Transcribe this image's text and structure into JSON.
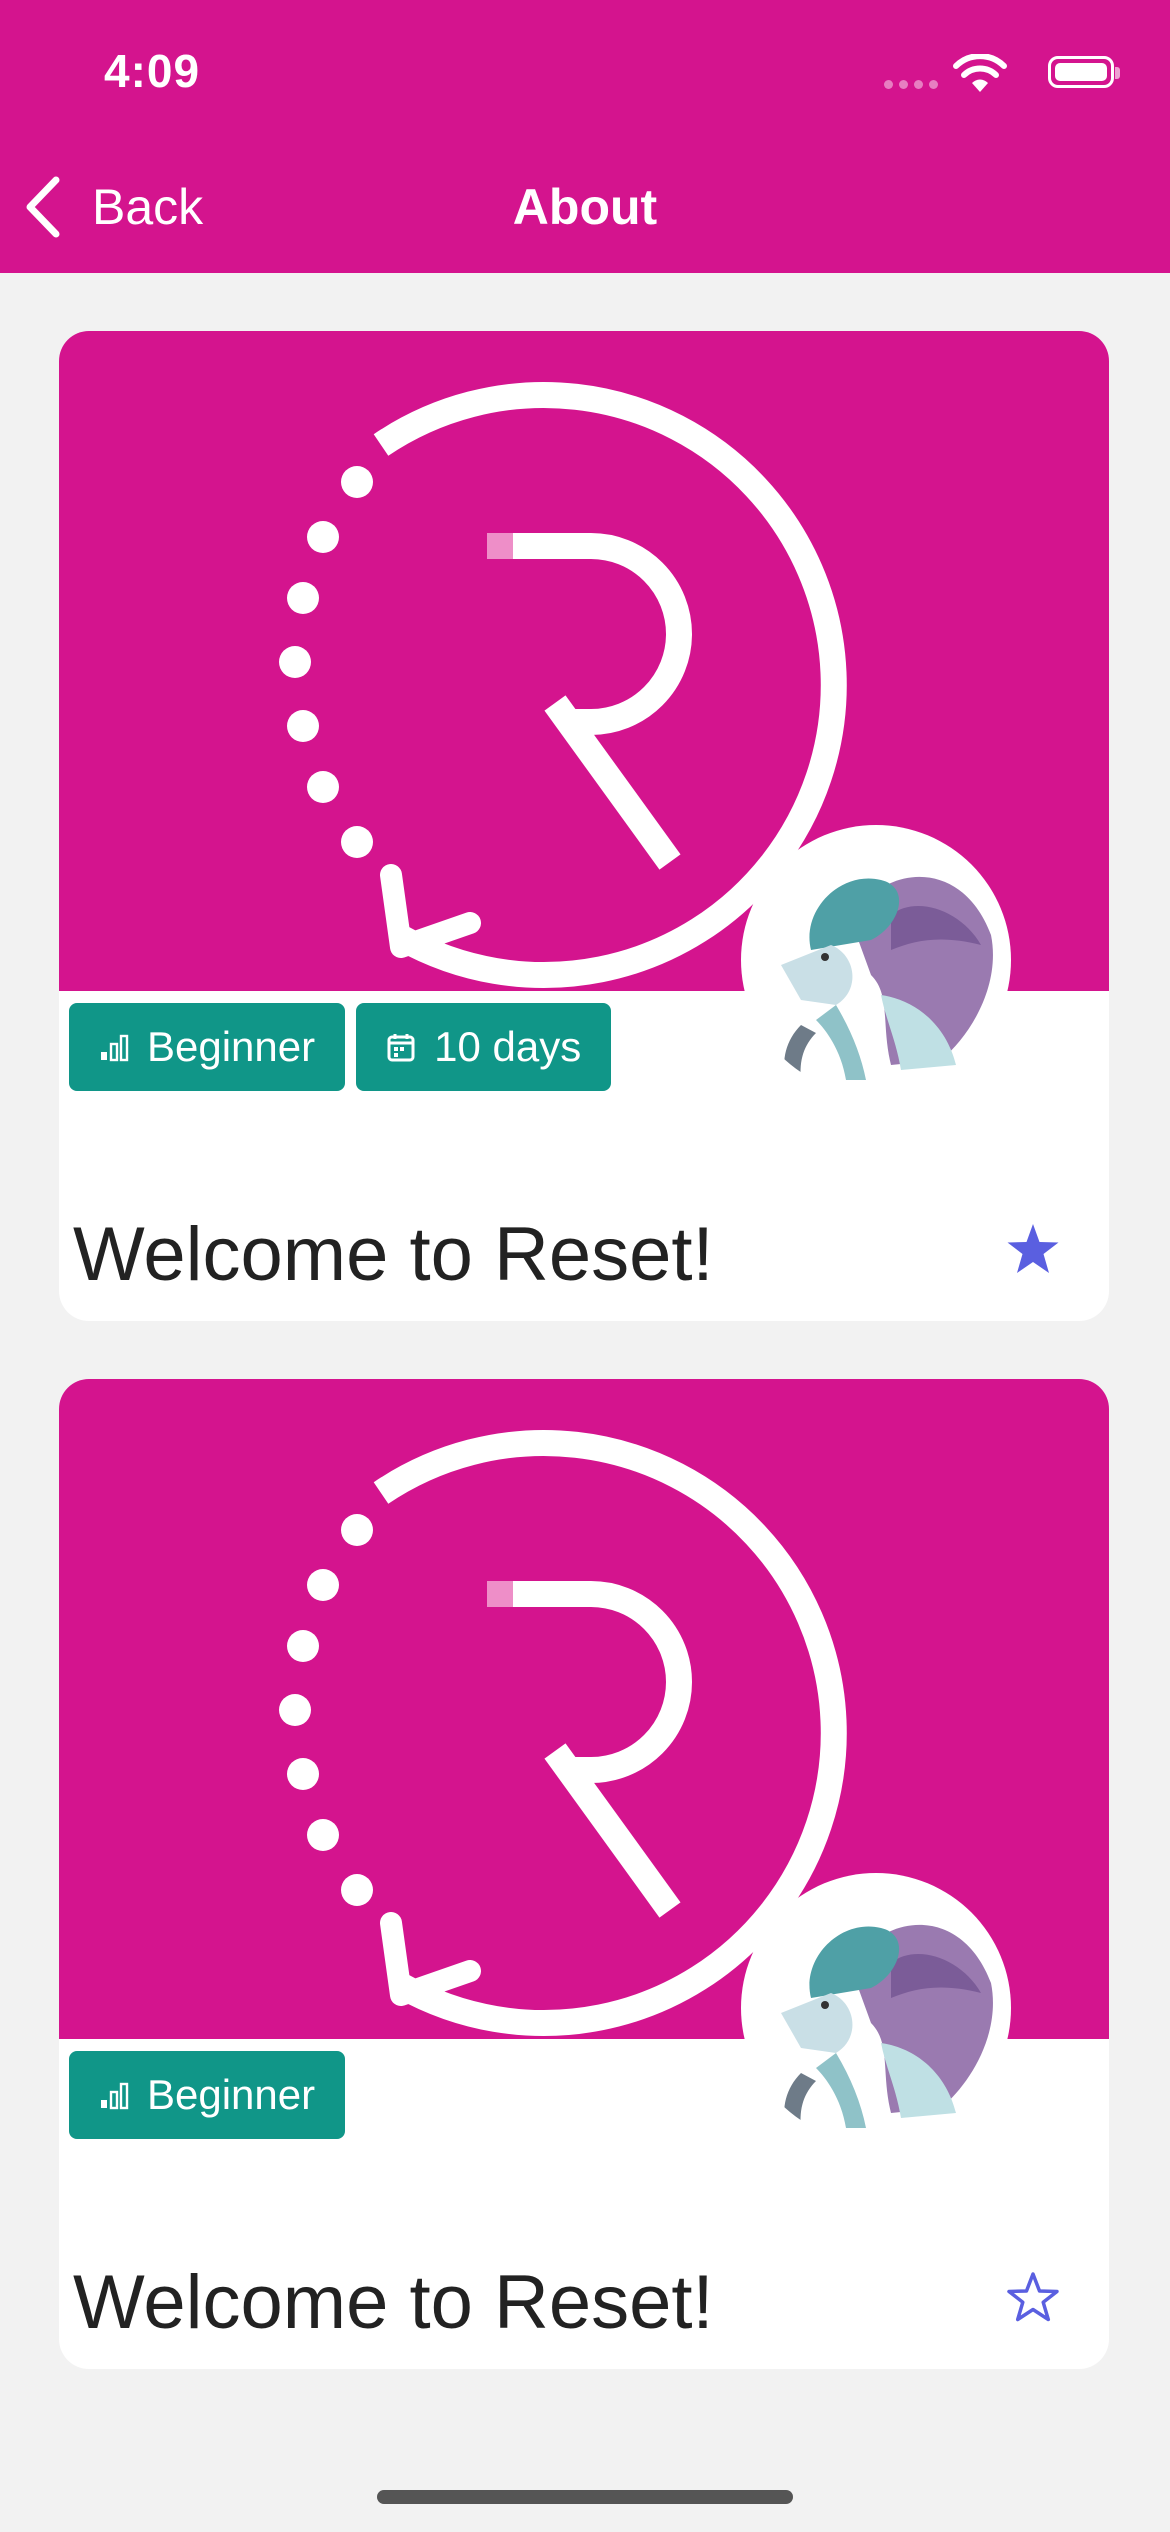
{
  "status_bar": {
    "time": "4:09"
  },
  "nav": {
    "back_label": "Back",
    "title": "About"
  },
  "cards": [
    {
      "badges": [
        {
          "icon": "level-bars-icon",
          "label": "Beginner"
        },
        {
          "icon": "calendar-icon",
          "label": "10 days"
        }
      ],
      "title": "Welcome to Reset!",
      "favorited": true
    },
    {
      "badges": [
        {
          "icon": "level-bars-icon",
          "label": "Beginner"
        }
      ],
      "title": "Welcome to Reset!",
      "favorited": false
    }
  ],
  "colors": {
    "brand": "#d4148e",
    "badge": "#109688",
    "star": "#5a5fe0",
    "background": "#f2f2f2"
  }
}
